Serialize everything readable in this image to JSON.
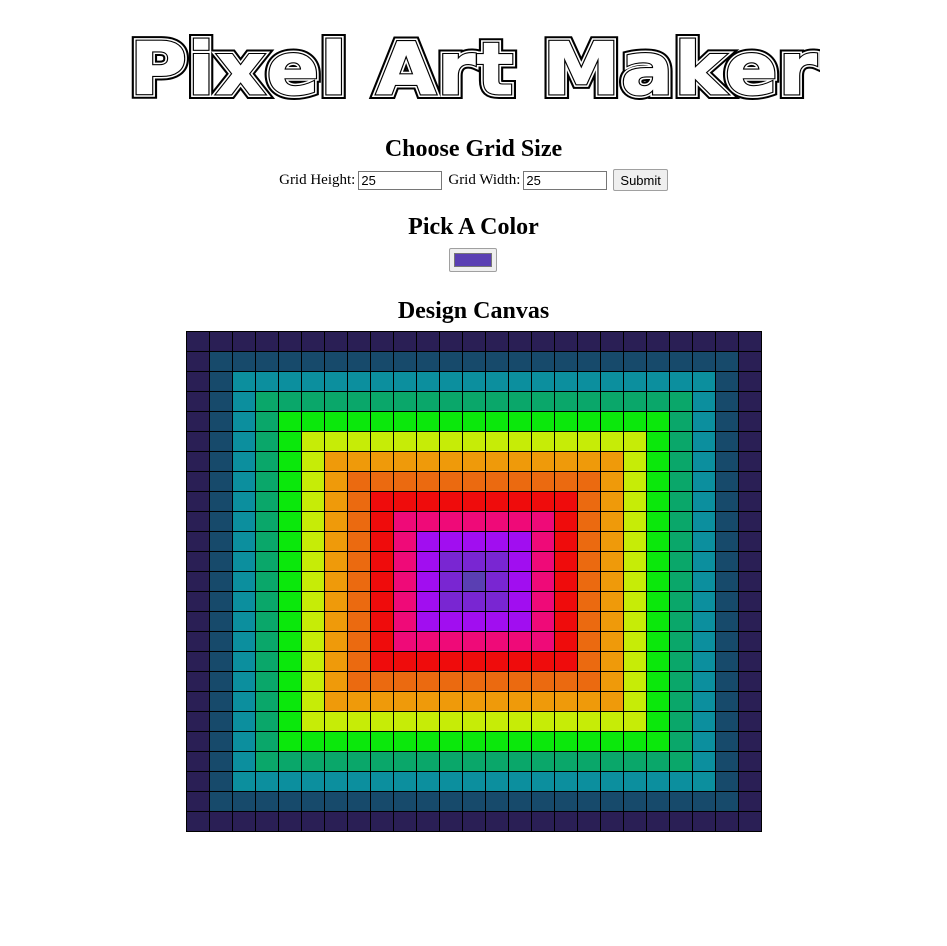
{
  "logo": {
    "text": "Pixel Art Maker"
  },
  "grid_section": {
    "heading": "Choose Grid Size",
    "height_label": "Grid Height:",
    "height_value": "25",
    "width_label": "Grid Width:",
    "width_value": "25",
    "submit_label": "Submit"
  },
  "color_section": {
    "heading": "Pick A Color",
    "selected_color": "#5a3fb3"
  },
  "canvas_section": {
    "heading": "Design Canvas",
    "rows": 25,
    "cols": 25,
    "ring_colors": [
      "#2a1f55",
      "#174a6b",
      "#0c8f9e",
      "#0aa76a",
      "#0be80c",
      "#c6ec07",
      "#ef9a0a",
      "#eb6a10",
      "#ef0c0c",
      "#ef0a78",
      "#a10ef0",
      "#7926d2",
      "#5a3fb3"
    ]
  }
}
